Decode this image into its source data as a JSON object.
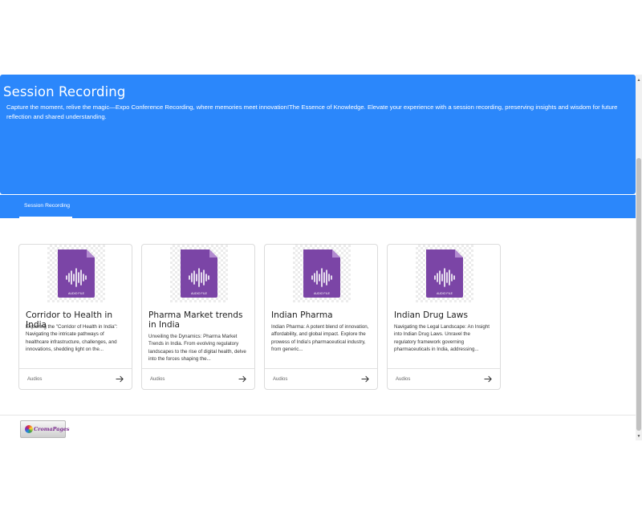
{
  "banner": {
    "title": "Session Recording",
    "description": "Capture the moment, relive the magic—Expo Conference Recording, where memories meet innovation!The Essence of Knowledge. Elevate your experience with a session recording, preserving insights and wisdom for future reflection and shared understanding.",
    "color": "#2b87fb"
  },
  "tabs": [
    {
      "label": "Session Recording",
      "active": true
    }
  ],
  "file_icon": {
    "label": "AUDIO FILE",
    "color": "#7b45a6"
  },
  "cards": [
    {
      "title": "Corridor to Health in India",
      "description": "Exploring the \"Corridor of Health in India\": Navigating the intricate pathways of healthcare infrastructure, challenges, and innovations, shedding light on the...",
      "category": "Audios",
      "icon": "arrow-right-icon"
    },
    {
      "title": "Pharma Market trends in India",
      "description": "Unveiling the Dynamics: Pharma Market Trends in India. From evolving regulatory landscapes to the rise of digital health, delve into the forces shaping the...",
      "category": "Audios",
      "icon": "arrow-right-icon"
    },
    {
      "title": "Indian Pharma",
      "description": "Indian Pharma: A potent blend of innovation, affordability, and global impact. Explore the prowess of India's pharmaceutical industry, from generic...",
      "category": "Audios",
      "icon": "arrow-right-icon"
    },
    {
      "title": "Indian Drug Laws",
      "description": "Navigating the Legal Landscape: An Insight into Indian Drug Laws. Unravel the regulatory framework governing pharmaceuticals in India, addressing...",
      "category": "Audios",
      "icon": "arrow-right-icon"
    }
  ],
  "footer": {
    "logo_text": "CromaPages"
  }
}
